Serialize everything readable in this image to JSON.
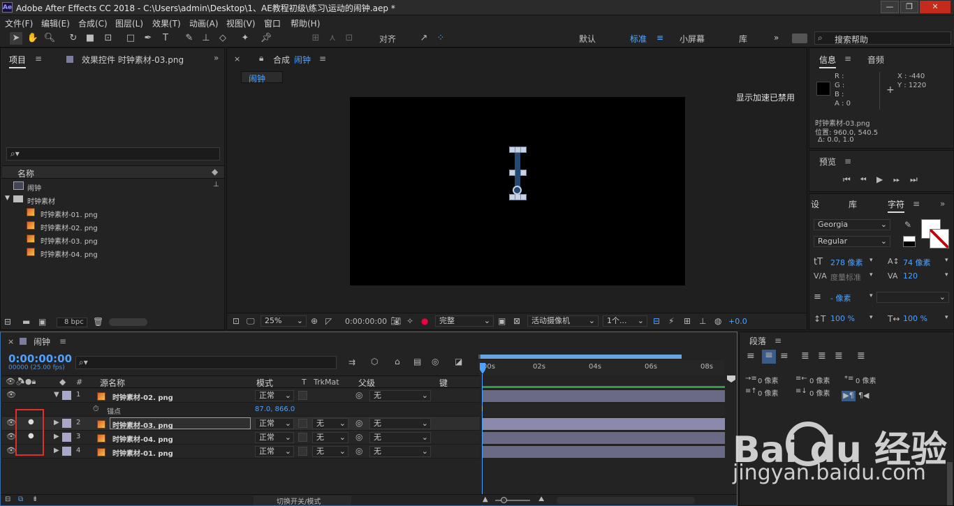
{
  "window": {
    "app_icon": "Ae",
    "title": "Adobe After Effects CC 2018 - C:\\Users\\admin\\Desktop\\1、AE教程初级\\练习\\运动的闹钟.aep *",
    "controls": [
      "—",
      "❐",
      "✕"
    ]
  },
  "menu": [
    "文件(F)",
    "编辑(E)",
    "合成(C)",
    "图层(L)",
    "效果(T)",
    "动画(A)",
    "视图(V)",
    "窗口",
    "帮助(H)"
  ],
  "toolbar": {
    "snap_label": "对齐",
    "workspaces": [
      "默认",
      "标准",
      "小屏幕",
      "库"
    ],
    "active_workspace": "标准",
    "search_placeholder": "搜索帮助"
  },
  "project_panel": {
    "tabs": [
      "项目",
      "效果控件 时钟素材-03.png"
    ],
    "column_name": "名称",
    "items": [
      {
        "name": "闹钟",
        "type": "comp"
      },
      {
        "name": "时钟素材",
        "type": "folder"
      },
      {
        "name": "时钟素材-01. png",
        "type": "file"
      },
      {
        "name": "时钟素材-02. png",
        "type": "file"
      },
      {
        "name": "时钟素材-03. png",
        "type": "file"
      },
      {
        "name": "时钟素材-04. png",
        "type": "file"
      }
    ],
    "bpc": "8 bpc"
  },
  "comp_panel": {
    "tab_prefix": "合成",
    "tab_name": "闹钟",
    "sub_tab": "闹钟",
    "notice": "显示加速已禁用",
    "zoom": "25%",
    "timecode": "0:00:00:00",
    "quality": "完整",
    "camera": "活动摄像机",
    "views": "1个...",
    "exposure": "+0.0"
  },
  "info_panel": {
    "tabs": [
      "信息",
      "音频"
    ],
    "r": "R :",
    "g": "G :",
    "b": "B :",
    "a": "A : 0",
    "x": "X : -440",
    "y": "Y : 1220",
    "layer": "时钟素材-03.png",
    "position": "位置: 960.0, 540.5",
    "delta": "Δ: 0.0, 1.0"
  },
  "preview_panel": {
    "title": "预览"
  },
  "character_panel": {
    "tabs": [
      "设",
      "库",
      "字符"
    ],
    "font": "Georgia",
    "style": "Regular",
    "size": "278 像素",
    "leading": "74 像素",
    "kerning": "度量标准",
    "tracking": "120",
    "stroke": "- 像素",
    "vscale": "100 %",
    "hscale": "100 %"
  },
  "paragraph_panel": {
    "title": "段落",
    "indent_left": "0 像素",
    "indent_right": "0 像素",
    "indent_first": "0 像素",
    "space_before": "0 像素",
    "space_after": "0 像素"
  },
  "timeline": {
    "tab": "闹钟",
    "timecode": "0:00:00:00",
    "frames": "00000 (25.00 fps)",
    "columns": {
      "num": "#",
      "name": "源名称",
      "mode": "模式",
      "t": "T",
      "trkmat": "TrkMat",
      "parent": "父级",
      "keys": "键"
    },
    "ruler": [
      "00s",
      "02s",
      "04s",
      "06s",
      "08s"
    ],
    "layers": [
      {
        "num": "1",
        "name": "时钟素材-02. png",
        "mode": "正常",
        "trkmat": "",
        "parent": "无",
        "expanded": true
      },
      {
        "num": "2",
        "name": "时钟素材-03. png",
        "mode": "正常",
        "trkmat": "无",
        "parent": "无",
        "expanded": false
      },
      {
        "num": "3",
        "name": "时钟素材-04. png",
        "mode": "正常",
        "trkmat": "无",
        "parent": "无",
        "expanded": false
      },
      {
        "num": "4",
        "name": "时钟素材-01. png",
        "mode": "正常",
        "trkmat": "无",
        "parent": "无",
        "expanded": false
      }
    ],
    "anchor_label": "锚点",
    "anchor_value": "87.0, 866.0",
    "toggle_label": "切换开关/模式"
  },
  "watermark": {
    "brand": "Bai du 经验",
    "url": "jingyan.baidu.com"
  },
  "colors": {
    "accent": "#4ea2ff",
    "highlight_box": "#e0302a",
    "layer_label": "#a9a7c7"
  }
}
